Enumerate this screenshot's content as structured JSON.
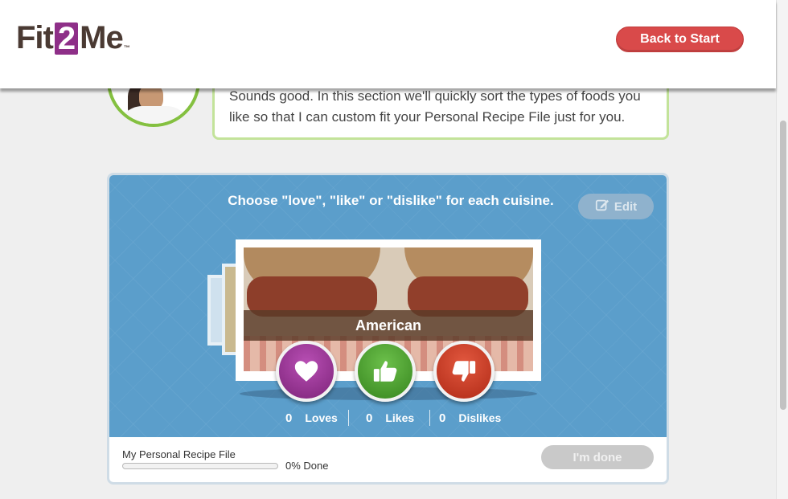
{
  "header": {
    "logo": {
      "part1": "Fit",
      "part2": "2",
      "part3": "Me",
      "tm": "™"
    },
    "back_button": "Back to Start"
  },
  "coach": {
    "message": "Sounds good. In this section we'll quickly sort the types of foods you like so that I can custom fit your Personal Recipe File just for you."
  },
  "cuisine_panel": {
    "instruction": "Choose \"love\", \"like\" or \"dislike\" for each cuisine.",
    "edit_label": "Edit",
    "current_card": {
      "name": "American"
    },
    "counts": {
      "loves": {
        "value": "0",
        "label": "Loves"
      },
      "likes": {
        "value": "0",
        "label": "Likes"
      },
      "dislikes": {
        "value": "0",
        "label": "Dislikes"
      }
    }
  },
  "footer": {
    "recipe_file_label": "My Personal Recipe File",
    "progress_percent": 0,
    "progress_text": "0% Done",
    "done_button": "I'm done"
  },
  "colors": {
    "brand_purple": "#8e2f88",
    "back_button": "#d94a4a",
    "panel_blue": "#5b9ecb",
    "love": "#9c3598",
    "like": "#4ea232",
    "dislike": "#cc3f28",
    "coach_green": "#84c040"
  },
  "icons": {
    "edit": "pencil-square-icon",
    "love": "heart-icon",
    "like": "thumbs-up-icon",
    "dislike": "thumbs-down-icon"
  }
}
